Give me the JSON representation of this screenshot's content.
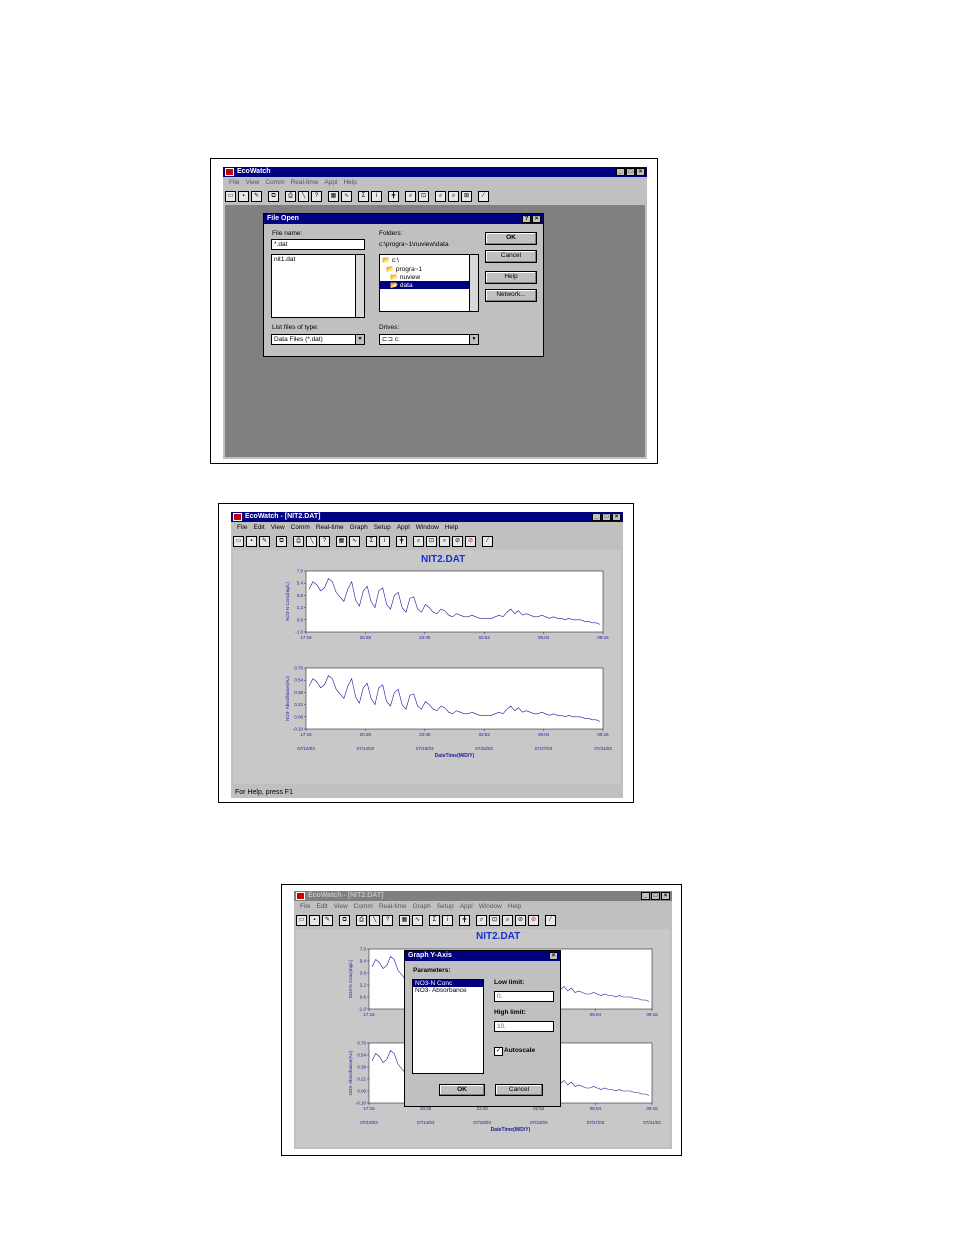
{
  "shot1": {
    "app_title": "EcoWatch",
    "menu": [
      "File",
      "View",
      "Comm",
      "Real-time",
      "Appl",
      "Help"
    ],
    "dialog": {
      "title": "File Open",
      "file_name_label": "File name:",
      "file_name_value": "*.dat",
      "files": [
        "nit1.dat"
      ],
      "folders_label": "Folders:",
      "folders_path": "c:\\progra~1\\nuview\\data",
      "folder_tree": [
        "c:\\",
        "progra~1",
        "nuview",
        "data"
      ],
      "list_type_label": "List files of type:",
      "list_type_value": "Data Files (*.dat)",
      "drives_label": "Drives:",
      "drives_value": "c:",
      "ok": "OK",
      "cancel": "Cancel",
      "help": "Help",
      "network": "Network..."
    }
  },
  "shot2": {
    "app_title": "EcoWatch - [NIT2.DAT]",
    "menu": [
      "File",
      "Edit",
      "View",
      "Comm",
      "Real-time",
      "Graph",
      "Setup",
      "Appl",
      "Window",
      "Help"
    ],
    "status": "For Help, press F1"
  },
  "shot3": {
    "app_title": "EcoWatch - [NIT2.DAT]",
    "menu": [
      "File",
      "Edit",
      "View",
      "Comm",
      "Real-time",
      "Graph",
      "Setup",
      "Appl",
      "Window",
      "Help"
    ],
    "dialog": {
      "title": "Graph Y-Axis",
      "parameters_label": "Parameters:",
      "parameters": [
        "NO3-N Conc",
        "NO3- Absorbance"
      ],
      "low_limit_label": "Low limit:",
      "low_limit_value": "0.",
      "high_limit_label": "High limit:",
      "high_limit_value": "10.",
      "autoscale_label": "Autoscale",
      "ok": "OK",
      "cancel": "Cancel"
    }
  },
  "chart_data": [
    {
      "type": "line",
      "title": "NIT2.DAT",
      "ylabel": "NO3-N Conc(mg/L)",
      "ylim": [
        -1.0,
        7.0
      ],
      "yticks": [
        "7.0",
        "5.4",
        "3.8",
        "2.2",
        "0.6",
        "-1.0"
      ],
      "xticks": [
        "17:16",
        "20:28",
        "23:40",
        "02:52",
        "06:04",
        "09:16"
      ],
      "color": "#1a1aa0",
      "series": [
        {
          "values": [
            4.6,
            5.6,
            5.2,
            4.4,
            4.8,
            6.0,
            5.6,
            4.2,
            3.6,
            3.0,
            4.6,
            5.6,
            3.2,
            2.4,
            4.4,
            5.0,
            3.0,
            2.2,
            4.4,
            4.8,
            2.6,
            2.0,
            3.8,
            4.2,
            2.2,
            1.6,
            3.4,
            3.6,
            2.0,
            1.6,
            2.6,
            2.2,
            1.6,
            1.4,
            2.0,
            1.8,
            1.2,
            1.0,
            1.4,
            1.2,
            1.0,
            1.0,
            1.2,
            1.0,
            0.8,
            0.8,
            0.8,
            0.8,
            1.0,
            1.2,
            1.0,
            1.6,
            2.0,
            1.4,
            1.8,
            1.2,
            1.4,
            1.2,
            1.0,
            1.0,
            1.2,
            1.0,
            0.8,
            1.0,
            0.8,
            0.8,
            0.6,
            0.8,
            0.6,
            0.6,
            0.6,
            0.4,
            0.4,
            0.2,
            0.2,
            0.0
          ]
        }
      ]
    },
    {
      "type": "line",
      "ylabel": "NO3- Absorbance(AU)",
      "ylim": [
        -0.1,
        0.7
      ],
      "yticks": [
        "0.70",
        "0.54",
        "0.38",
        "0.22",
        "0.06",
        "-0.10"
      ],
      "xticks": [
        "17:16",
        "20:28",
        "23:40",
        "02:52",
        "06:04",
        "09:16"
      ],
      "xdates": [
        "07/10/03",
        "07/14/03",
        "07/18/03",
        "07/23/03",
        "07/27/03",
        "07/31/03"
      ],
      "xlabel": "DateTime(M/D/Y)",
      "color": "#1a1aa0",
      "series": [
        {
          "values": [
            0.46,
            0.56,
            0.52,
            0.44,
            0.48,
            0.6,
            0.56,
            0.42,
            0.36,
            0.3,
            0.46,
            0.56,
            0.32,
            0.24,
            0.44,
            0.5,
            0.3,
            0.22,
            0.44,
            0.48,
            0.26,
            0.2,
            0.38,
            0.42,
            0.22,
            0.16,
            0.34,
            0.36,
            0.2,
            0.16,
            0.26,
            0.22,
            0.16,
            0.14,
            0.2,
            0.18,
            0.12,
            0.1,
            0.14,
            0.12,
            0.1,
            0.1,
            0.12,
            0.1,
            0.08,
            0.08,
            0.08,
            0.08,
            0.1,
            0.12,
            0.1,
            0.16,
            0.2,
            0.14,
            0.18,
            0.12,
            0.14,
            0.12,
            0.1,
            0.1,
            0.12,
            0.1,
            0.08,
            0.1,
            0.08,
            0.08,
            0.06,
            0.08,
            0.06,
            0.06,
            0.06,
            0.04,
            0.04,
            0.02,
            0.02,
            0.0
          ]
        }
      ]
    }
  ]
}
